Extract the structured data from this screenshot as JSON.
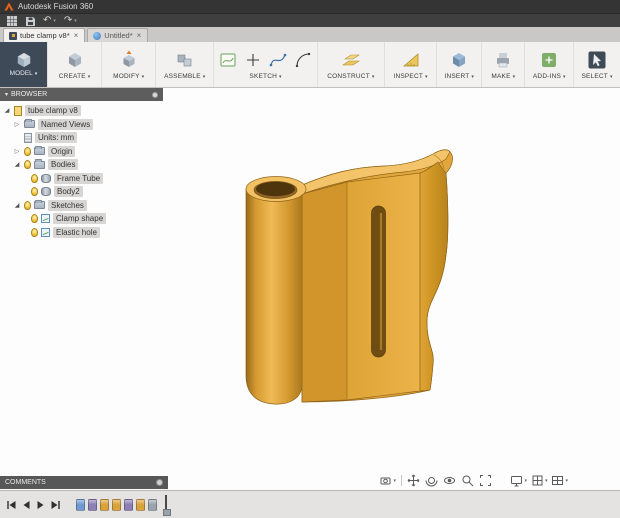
{
  "titlebar": {
    "title": "Autodesk Fusion 360",
    "logo_icon": "autodesk-a-logo"
  },
  "quickbar": {
    "icons": [
      "data-panel-grid",
      "save",
      "undo",
      "redo"
    ]
  },
  "tabs": [
    {
      "label": "tube clamp v8*",
      "icon": "design-tab-icon",
      "active": true
    },
    {
      "label": "Untitled*",
      "icon": "new-design-globe-icon",
      "active": false
    }
  ],
  "toolbar": {
    "model_label": "MODEL",
    "groups": [
      {
        "label": "CREATE",
        "icons": [
          "create-cube"
        ]
      },
      {
        "label": "MODIFY",
        "icons": [
          "press-pull"
        ]
      },
      {
        "label": "ASSEMBLE",
        "icons": [
          "assemble-components"
        ]
      },
      {
        "label": "SKETCH",
        "icons": [
          "create-sketch",
          "sketch-point",
          "sketch-spline",
          "sketch-arc"
        ]
      },
      {
        "label": "CONSTRUCT",
        "icons": [
          "construction-planes"
        ]
      },
      {
        "label": "INSPECT",
        "icons": [
          "measure"
        ]
      },
      {
        "label": "INSERT",
        "icons": [
          "insert-mesh"
        ]
      },
      {
        "label": "MAKE",
        "icons": [
          "3d-print"
        ]
      },
      {
        "label": "ADD-INS",
        "icons": [
          "scripts-addins"
        ]
      },
      {
        "label": "SELECT",
        "icons": [
          "select-cursor"
        ]
      }
    ]
  },
  "browser": {
    "title": "BROWSER",
    "items": [
      {
        "label": "tube clamp v8",
        "level": 0,
        "expand": "expanded",
        "icon": "design-document",
        "bulb": false
      },
      {
        "label": "Named Views",
        "level": 1,
        "expand": "collapsed",
        "icon": "folder",
        "bulb": false
      },
      {
        "label": "Units: mm",
        "level": 1,
        "expand": "none",
        "icon": "units-document",
        "bulb": false
      },
      {
        "label": "Origin",
        "level": 1,
        "expand": "collapsed",
        "icon": "folder",
        "bulb": true
      },
      {
        "label": "Bodies",
        "level": 1,
        "expand": "expanded",
        "icon": "folder",
        "bulb": true
      },
      {
        "label": "Frame Tube",
        "level": 2,
        "expand": "none",
        "icon": "body",
        "bulb": true
      },
      {
        "label": "Body2",
        "level": 2,
        "expand": "none",
        "icon": "body",
        "bulb": true
      },
      {
        "label": "Sketches",
        "level": 1,
        "expand": "expanded",
        "icon": "folder",
        "bulb": true
      },
      {
        "label": "Clamp shape",
        "level": 2,
        "expand": "none",
        "icon": "sketch",
        "bulb": true
      },
      {
        "label": "Elastic hole",
        "level": 2,
        "expand": "none",
        "icon": "sketch",
        "bulb": true
      }
    ]
  },
  "comments": {
    "label": "COMMENTS",
    "icons": [
      "comments-indicator-dot"
    ]
  },
  "playback": {
    "icons": [
      "skip-to-start",
      "step-back",
      "play-forward",
      "skip-to-end"
    ]
  },
  "timeline": {
    "features": [
      {
        "type": "sketch",
        "color": "#6f9bd1"
      },
      {
        "type": "sketch",
        "color": "#8d7fb5"
      },
      {
        "type": "extrude",
        "color": "#d9a33b"
      },
      {
        "type": "extrude",
        "color": "#d9a33b"
      },
      {
        "type": "sketch",
        "color": "#8d7fb5"
      },
      {
        "type": "extrude",
        "color": "#d9a33b"
      },
      {
        "type": "feature",
        "color": "#9aa4ae"
      }
    ]
  },
  "navbar": {
    "icons": [
      "capture",
      "pan",
      "orbit",
      "look-at",
      "zoom",
      "fit"
    ]
  },
  "display_bar": {
    "icons": [
      "display-settings",
      "grid-and-snaps",
      "viewports"
    ]
  },
  "model": {
    "name": "tube clamp body",
    "body_color": "#e2a73c",
    "highlight_color": "#f3c469",
    "shadow_color": "#8f6317",
    "canvas_background": "#fdfdfd"
  }
}
